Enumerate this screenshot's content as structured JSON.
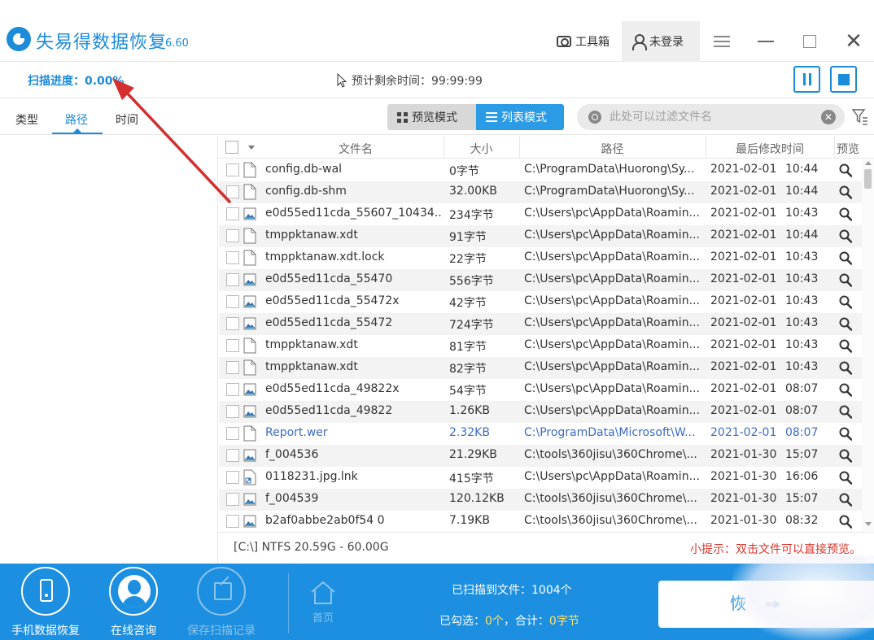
{
  "app": {
    "title": "失易得数据恢复",
    "version": "6.60"
  },
  "titlebar": {
    "toolbox_label": "工具箱",
    "login_label": "未登录",
    "icons": [
      "camera-icon",
      "user-icon",
      "menu-icon",
      "minimize-icon",
      "maximize-icon",
      "close-icon"
    ]
  },
  "progress": {
    "label": "扫描进度：0.00%",
    "percent": 0.0,
    "remaining": "预计剩余时间：99:99:99"
  },
  "tabs": [
    {
      "label": "类型",
      "active": false
    },
    {
      "label": "路径",
      "active": true
    },
    {
      "label": "时间",
      "active": false
    }
  ],
  "view_modes": {
    "preview": "预览模式",
    "list": "列表模式",
    "active": "list"
  },
  "filter": {
    "placeholder": "此处可以过滤文件名"
  },
  "table": {
    "columns": [
      "文件名",
      "大小",
      "路径",
      "最后修改时间",
      "预览"
    ],
    "rows": [
      {
        "name": "config.db-wal",
        "size": "0字节",
        "path": "C:\\ProgramData\\Huorong\\Sy...",
        "date": "2021-02-01",
        "time": "10:44",
        "icon": "file-icon"
      },
      {
        "name": "config.db-shm",
        "size": "32.00KB",
        "path": "C:\\ProgramData\\Huorong\\Sy...",
        "date": "2021-02-01",
        "time": "10:44",
        "icon": "file-icon"
      },
      {
        "name": "e0d55ed11cda_55607_10434...",
        "size": "234字节",
        "path": "C:\\Users\\pc\\AppData\\Roamin...",
        "date": "2021-02-01",
        "time": "10:43",
        "icon": "image-file-icon"
      },
      {
        "name": "tmppktanaw.xdt",
        "size": "91字节",
        "path": "C:\\Users\\pc\\AppData\\Roamin...",
        "date": "2021-02-01",
        "time": "10:44",
        "icon": "file-icon"
      },
      {
        "name": "tmppktanaw.xdt.lock",
        "size": "22字节",
        "path": "C:\\Users\\pc\\AppData\\Roamin...",
        "date": "2021-02-01",
        "time": "10:43",
        "icon": "file-icon"
      },
      {
        "name": "e0d55ed11cda_55470",
        "size": "556字节",
        "path": "C:\\Users\\pc\\AppData\\Roamin...",
        "date": "2021-02-01",
        "time": "10:43",
        "icon": "image-file-icon"
      },
      {
        "name": "e0d55ed11cda_55472x",
        "size": "42字节",
        "path": "C:\\Users\\pc\\AppData\\Roamin...",
        "date": "2021-02-01",
        "time": "10:43",
        "icon": "image-file-icon"
      },
      {
        "name": "e0d55ed11cda_55472",
        "size": "724字节",
        "path": "C:\\Users\\pc\\AppData\\Roamin...",
        "date": "2021-02-01",
        "time": "10:43",
        "icon": "image-file-icon"
      },
      {
        "name": "tmppktanaw.xdt",
        "size": "81字节",
        "path": "C:\\Users\\pc\\AppData\\Roamin...",
        "date": "2021-02-01",
        "time": "10:43",
        "icon": "file-icon"
      },
      {
        "name": "tmppktanaw.xdt",
        "size": "82字节",
        "path": "C:\\Users\\pc\\AppData\\Roamin...",
        "date": "2021-02-01",
        "time": "10:43",
        "icon": "file-icon"
      },
      {
        "name": "e0d55ed11cda_49822x",
        "size": "54字节",
        "path": "C:\\Users\\pc\\AppData\\Roamin...",
        "date": "2021-02-01",
        "time": "08:07",
        "icon": "image-file-icon"
      },
      {
        "name": "e0d55ed11cda_49822",
        "size": "1.26KB",
        "path": "C:\\Users\\pc\\AppData\\Roamin...",
        "date": "2021-02-01",
        "time": "08:07",
        "icon": "image-file-icon"
      },
      {
        "name": "Report.wer",
        "size": "2.32KB",
        "path": "C:\\ProgramData\\Microsoft\\W...",
        "date": "2021-02-01",
        "time": "08:07",
        "icon": "file-icon",
        "highlight": true
      },
      {
        "name": "f_004536",
        "size": "21.29KB",
        "path": "C:\\tools\\360jisu\\360Chrome\\...",
        "date": "2021-01-30",
        "time": "15:07",
        "icon": "image-file-icon"
      },
      {
        "name": "0118231.jpg.lnk",
        "size": "415字节",
        "path": "C:\\Users\\pc\\AppData\\Roamin...",
        "date": "2021-01-30",
        "time": "16:06",
        "icon": "shortcut-file-icon"
      },
      {
        "name": "f_004539",
        "size": "120.12KB",
        "path": "C:\\tools\\360jisu\\360Chrome\\...",
        "date": "2021-01-30",
        "time": "15:07",
        "icon": "image-file-icon"
      },
      {
        "name": "b2af0abbe2ab0f54 0",
        "size": "7.19KB",
        "path": "C:\\tools\\360jisu\\360Chrome\\...",
        "date": "2021-01-30",
        "time": "08:32",
        "icon": "image-file-icon"
      }
    ]
  },
  "status": {
    "disk": "[C:\\] NTFS 20.59G - 60.00G",
    "tip": "小提示：双击文件可以直接预览。"
  },
  "bottom": {
    "phone_recovery": "手机数据恢复",
    "online_consult": "在线咨询",
    "save_scan": "保存扫描记录",
    "home": "首页",
    "scanned_prefix": "已扫描到文件：",
    "scanned_count": "1004个",
    "selected_prefix": "已勾选：",
    "selected_count": "0个",
    "total_prefix": "，合计：",
    "total_size": "0字节",
    "recover_label": "恢"
  },
  "colors": {
    "accent": "#1c8fe0",
    "tip_red": "#d9352a",
    "highlight_blue": "#3d6cc6",
    "annotation_red": "#d32f2f"
  }
}
